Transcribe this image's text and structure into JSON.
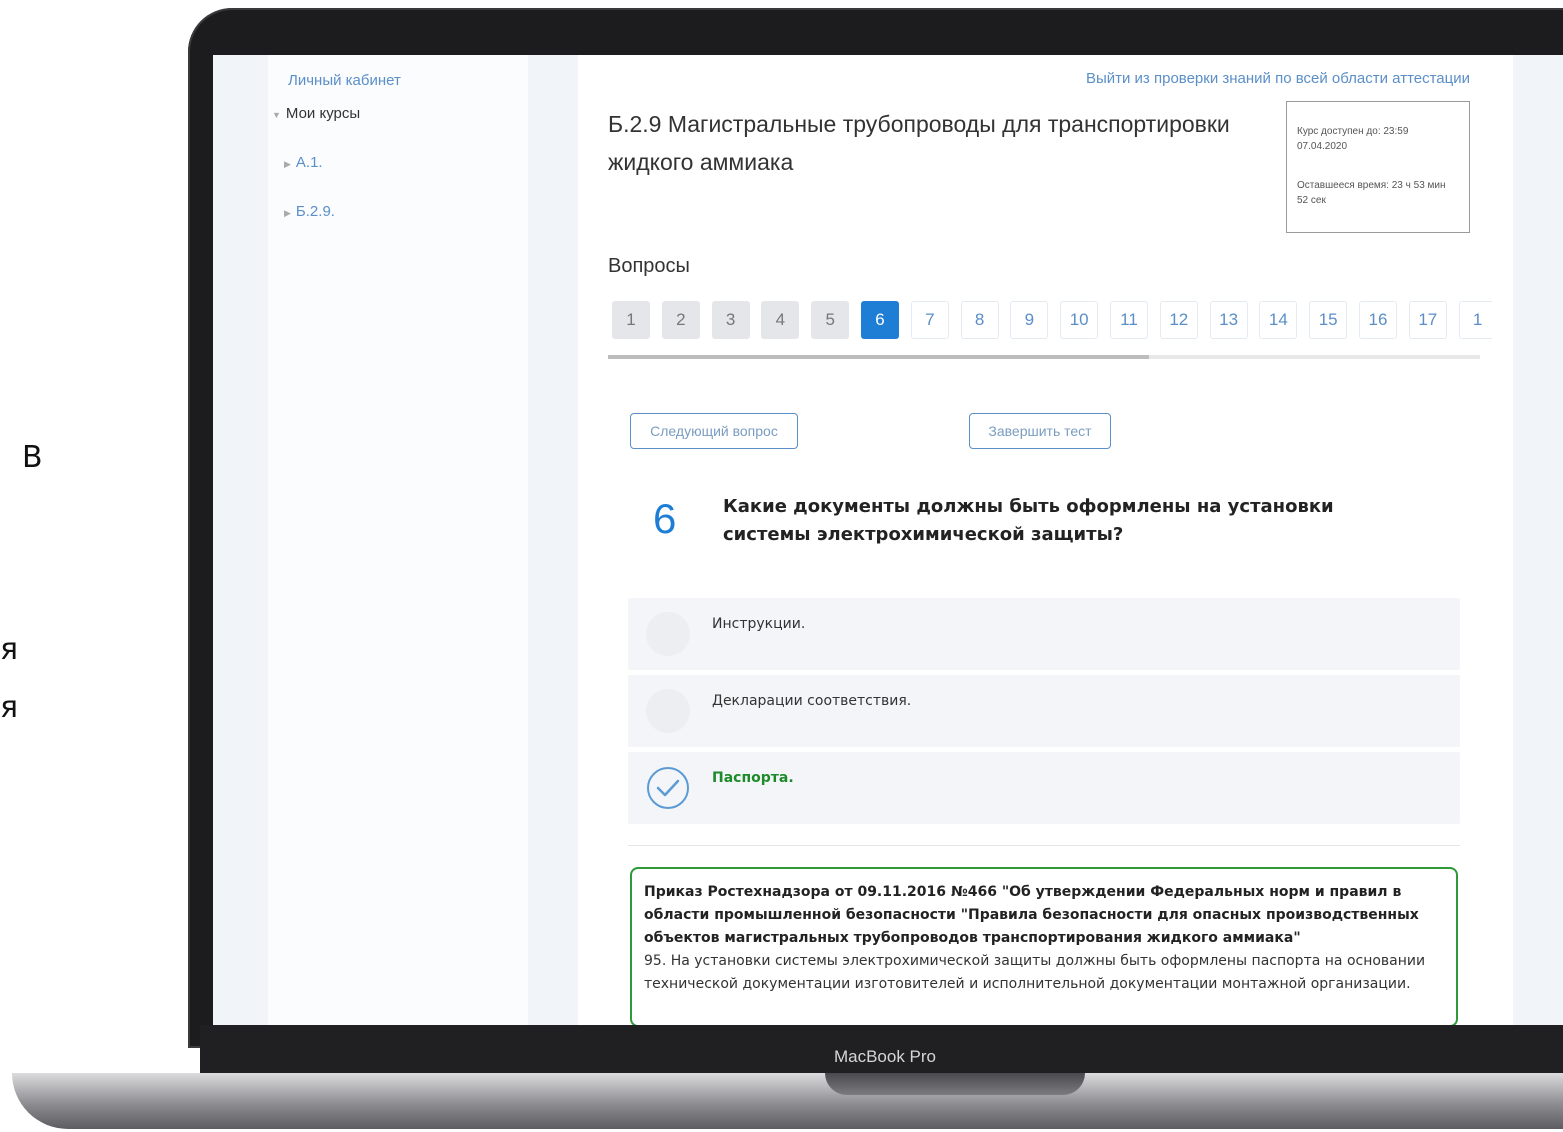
{
  "side_fragments": [
    "В",
    "я",
    "я"
  ],
  "device": {
    "label": "MacBook Pro"
  },
  "sidebar": {
    "account_link": "Личный кабинет",
    "my_courses": "Мои курсы",
    "courses": [
      "А.1.",
      "Б.2.9."
    ]
  },
  "header": {
    "exit_link": "Выйти из проверки знаний по всей области аттестации",
    "course_title": "Б.2.9 Магистральные трубопроводы для транспортировки жидкого аммиака",
    "timer": {
      "available_until": "Курс доступен до: 23:59 07.04.2020",
      "time_left": "Оставшееся время: 23 ч 53 мин 52 сек"
    }
  },
  "questions": {
    "title": "Вопросы",
    "items": [
      "1",
      "2",
      "3",
      "4",
      "5",
      "6",
      "7",
      "8",
      "9",
      "10",
      "11",
      "12",
      "13",
      "14",
      "15",
      "16",
      "17",
      "1"
    ],
    "current_index": 5,
    "answered_count": 5,
    "progress_fraction": 0.62
  },
  "actions": {
    "next_label": "Следующий вопрос",
    "finish_label": "Завершить тест"
  },
  "question": {
    "number": "6",
    "text": "Какие документы должны быть оформлены на установки системы электрохимической защиты?",
    "answers": [
      {
        "text": "Инструкции.",
        "correct": false
      },
      {
        "text": "Декларации соответствия.",
        "correct": false
      },
      {
        "text": "Паспорта.",
        "correct": true
      }
    ]
  },
  "reference": {
    "title": "Приказ Ростехнадзора от 09.11.2016 №466 \"Об утверждении Федеральных норм и правил в области промышленной безопасности \"Правила безопасности для опасных производственных объектов магистральных трубопроводов транспортирования жидкого аммиака\"",
    "body": "95. На установки системы электрохимической защиты должны быть оформлены паспорта на основании технической документации изготовителей и исполнительной документации монтажной организации."
  },
  "colors": {
    "accent": "#1e7ed6",
    "correct": "#2e9a3a",
    "link": "#5b8fc7"
  }
}
